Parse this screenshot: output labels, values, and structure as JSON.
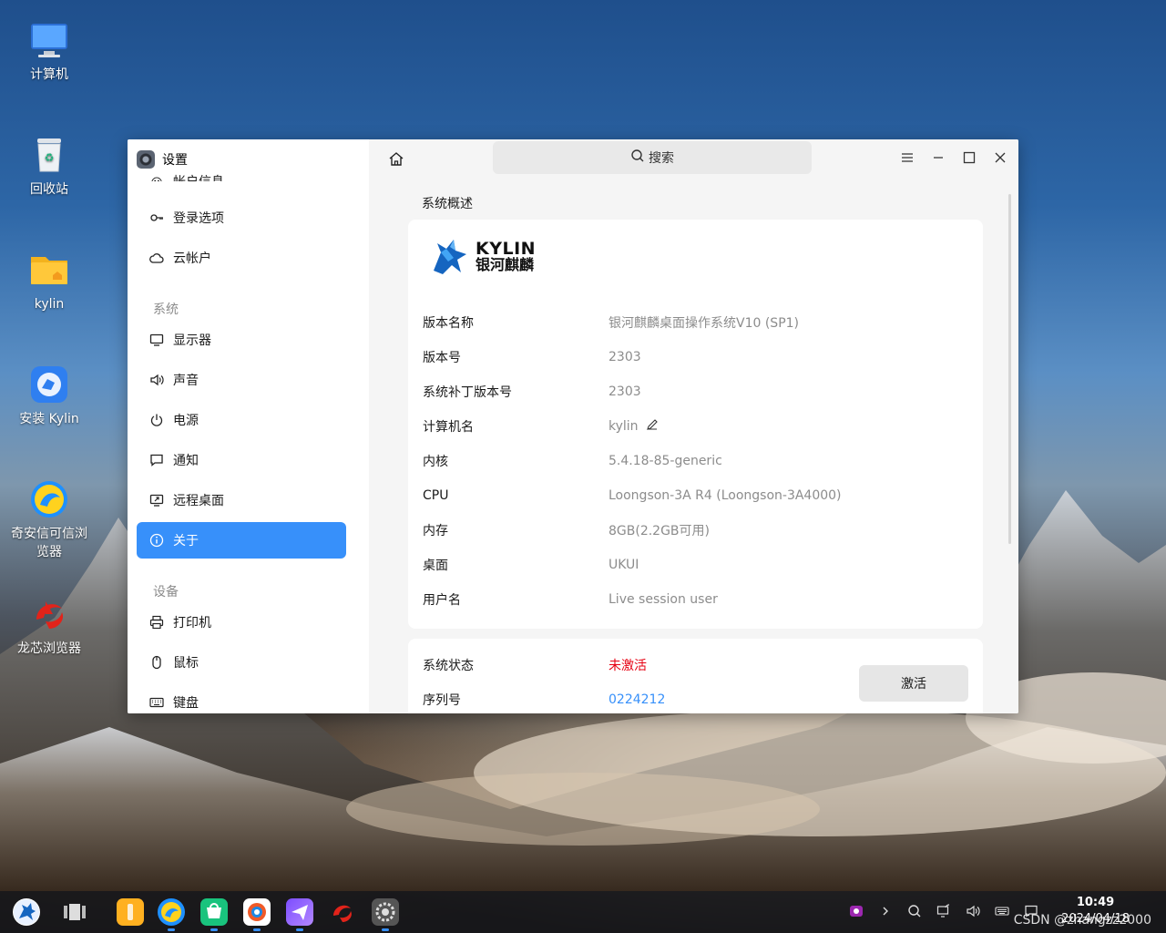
{
  "desktop": {
    "icons": [
      {
        "label": "计算机"
      },
      {
        "label": "回收站"
      },
      {
        "label": "kylin"
      },
      {
        "label": "安装 Kylin"
      },
      {
        "label": "奇安信可信浏览器"
      },
      {
        "label": "龙芯浏览器"
      }
    ]
  },
  "window": {
    "app_title": "设置",
    "search_placeholder": "搜索",
    "sidebar": {
      "partial_top": "帐户信息",
      "items_account": [
        {
          "label": "登录选项"
        },
        {
          "label": "云帐户"
        }
      ],
      "group_system": "系统",
      "items_system": [
        {
          "label": "显示器"
        },
        {
          "label": "声音"
        },
        {
          "label": "电源"
        },
        {
          "label": "通知"
        },
        {
          "label": "远程桌面"
        },
        {
          "label": "关于"
        }
      ],
      "group_device": "设备",
      "items_device": [
        {
          "label": "打印机"
        },
        {
          "label": "鼠标"
        },
        {
          "label": "键盘"
        }
      ]
    },
    "main": {
      "section_title": "系统概述",
      "logo_text_en": "KYLIN",
      "logo_text_cn": "银河麒麟",
      "info": [
        {
          "key": "版本名称",
          "value": "银河麒麟桌面操作系统V10 (SP1)"
        },
        {
          "key": "版本号",
          "value": "2303"
        },
        {
          "key": "系统补丁版本号",
          "value": "2303"
        },
        {
          "key": "计算机名",
          "value": "kylin"
        },
        {
          "key": "内核",
          "value": "5.4.18-85-generic"
        },
        {
          "key": "CPU",
          "value": "Loongson-3A R4 (Loongson-3A4000)"
        },
        {
          "key": "内存",
          "value": "8GB(2.2GB可用)"
        },
        {
          "key": "桌面",
          "value": "UKUI"
        },
        {
          "key": "用户名",
          "value": "Live session user"
        }
      ],
      "status": [
        {
          "key": "系统状态",
          "value": "未激活"
        },
        {
          "key": "序列号",
          "value": "0224212"
        }
      ],
      "activate_label": "激活"
    }
  },
  "taskbar": {
    "time": "10:49",
    "date": "2024/04/18",
    "watermark": "CSDN @zhangzz2000"
  },
  "colors": {
    "accent": "#3790fa",
    "inactive_red": "#e60012",
    "value_gray": "#8c8c8c"
  }
}
